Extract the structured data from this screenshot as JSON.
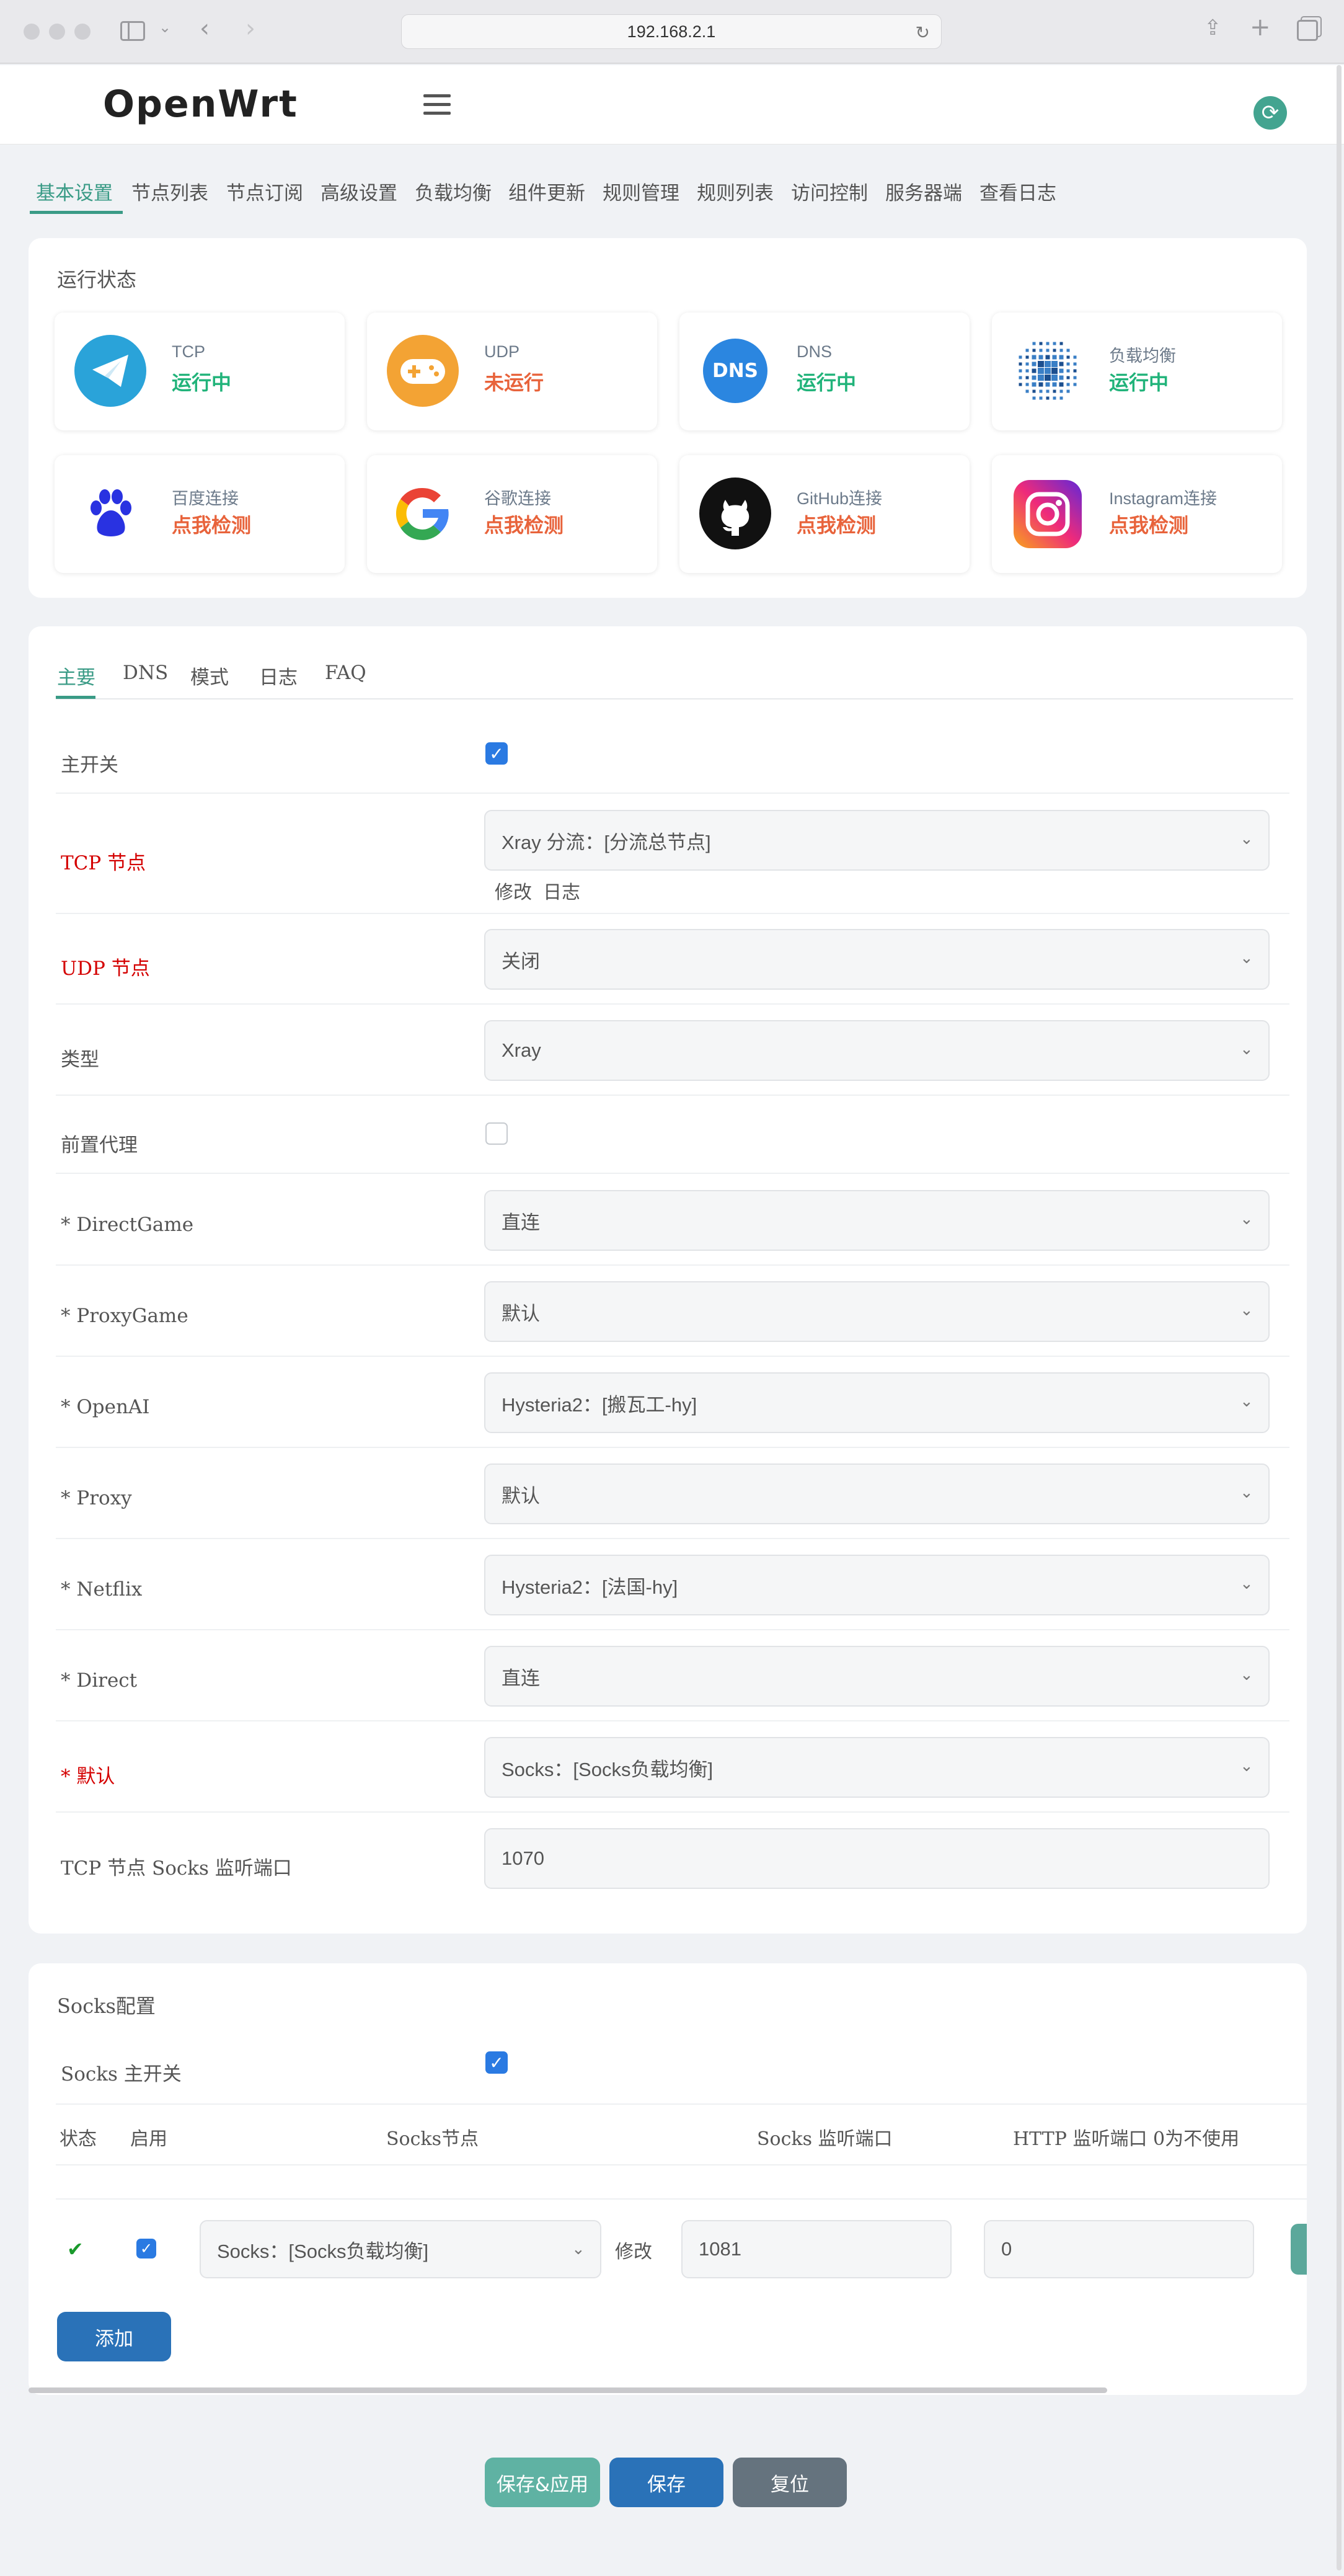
{
  "browser": {
    "url": "192.168.2.1"
  },
  "header": {
    "logo": "OpenWrt"
  },
  "tabs": [
    "基本设置",
    "节点列表",
    "节点订阅",
    "高级设置",
    "负载均衡",
    "组件更新",
    "规则管理",
    "规则列表",
    "访问控制",
    "服务器端",
    "查看日志"
  ],
  "status": {
    "title": "运行状态",
    "cards": [
      {
        "name": "TCP",
        "value": "运行中",
        "state": "green",
        "icon": "telegram-icon",
        "color": "#2aa3d9"
      },
      {
        "name": "UDP",
        "value": "未运行",
        "state": "red",
        "icon": "gamepad-icon",
        "color": "#f3a334"
      },
      {
        "name": "DNS",
        "value": "运行中",
        "state": "green",
        "icon": "dns-icon",
        "color": "#2b86e0",
        "icon_text": "DNS"
      },
      {
        "name": "负载均衡",
        "value": "运行中",
        "state": "green",
        "icon": "network-grid-icon",
        "color": "#2f6fb3"
      },
      {
        "name": "百度连接",
        "value": "点我检测",
        "state": "red",
        "icon": "baidu-paw-icon",
        "color": "#2932e1"
      },
      {
        "name": "谷歌连接",
        "value": "点我检测",
        "state": "red",
        "icon": "google-icon",
        "color": "#4285f4"
      },
      {
        "name": "GitHub连接",
        "value": "点我检测",
        "state": "red",
        "icon": "github-icon",
        "color": "#111111"
      },
      {
        "name": "Instagram连接",
        "value": "点我检测",
        "state": "red",
        "icon": "instagram-icon",
        "color": "#d6249f"
      }
    ]
  },
  "subtabs": [
    "主要",
    "DNS",
    "模式",
    "日志",
    "FAQ"
  ],
  "form": {
    "main_switch": {
      "label": "主开关",
      "checked": true
    },
    "tcp_node": {
      "label": "TCP 节点",
      "value": "Xray 分流：[分流总节点]",
      "edit": "修改",
      "log": "日志"
    },
    "udp_node": {
      "label": "UDP 节点",
      "value": "关闭"
    },
    "type": {
      "label": "类型",
      "value": "Xray"
    },
    "pre_proxy": {
      "label": "前置代理",
      "checked": false
    },
    "rules": [
      {
        "label": "* DirectGame",
        "value": "直连",
        "required": false
      },
      {
        "label": "* ProxyGame",
        "value": "默认",
        "required": false
      },
      {
        "label": "* OpenAI",
        "value": "Hysteria2：[搬瓦工-hy]",
        "required": false
      },
      {
        "label": "* Proxy",
        "value": "默认",
        "required": false
      },
      {
        "label": "* Netflix",
        "value": "Hysteria2：[法国-hy]",
        "required": false
      },
      {
        "label": "* Direct",
        "value": "直连",
        "required": false
      },
      {
        "label": "* 默认",
        "value": "Socks：[Socks负载均衡]",
        "required": true
      }
    ],
    "socks_port": {
      "label": "TCP 节点 Socks 监听端口",
      "value": "1070"
    }
  },
  "socks": {
    "title": "Socks配置",
    "switch_label": "Socks 主开关",
    "headers": [
      "状态",
      "启用",
      "Socks节点",
      "Socks 监听端口",
      "HTTP 监听端口 0为不使用"
    ],
    "row": {
      "status": "✔",
      "node": "Socks：[Socks负载均衡]",
      "edit": "修改",
      "port": "1081",
      "http_port": "0"
    },
    "add": "添加"
  },
  "footer": {
    "save_apply": "保存&应用",
    "save": "保存",
    "reset": "复位"
  },
  "colors": {
    "accent": "#3a9b86",
    "primary": "#2a72b8",
    "ok": "#21b37a",
    "warn": "#e8633b",
    "required": "#d40000"
  }
}
